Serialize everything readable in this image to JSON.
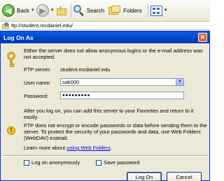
{
  "toolbar": {
    "back_label": "Back",
    "search_label": "Search",
    "folders_label": "Folders"
  },
  "address": {
    "value": "ftp://student.mcdaniel.edu/"
  },
  "dialog": {
    "title": "Log On As",
    "message": "Either the server does not allow anonymous logins or the e-mail address was not accepted.",
    "ftp_server_label": "FTP server:",
    "ftp_server_value": "student.mcdaniel.edu",
    "username_label": "User name:",
    "username_value": "sak000",
    "password_label": "Password:",
    "password_value": "●●●●●●●●●",
    "after_logon_text": "After you log on, you can add this server to your Favorites and return to it easily.",
    "warning_text": "FTP does not encrypt or encode passwords or data before sending them to the server. To protect the security of your passwords and data, use Web Folders (WebDAV) instead.",
    "learn_more_prefix": "Learn more about ",
    "learn_more_link": "using Web Folders",
    "learn_more_suffix": ".",
    "log_on_anonymously_label": "Log on anonymously",
    "save_password_label": "Save password",
    "log_on_button": "Log On",
    "cancel_button": "Cancel"
  }
}
